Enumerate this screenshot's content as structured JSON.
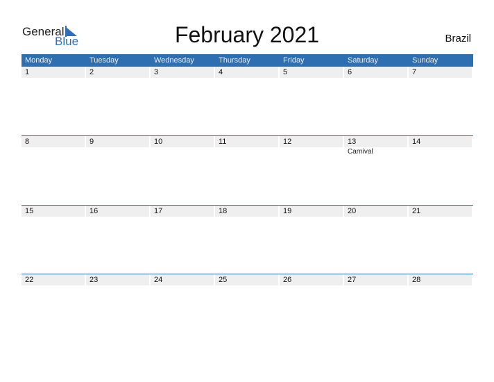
{
  "logo": {
    "general": "General",
    "blue": "Blue"
  },
  "title": "February 2021",
  "country": "Brazil",
  "weekdays": [
    "Monday",
    "Tuesday",
    "Wednesday",
    "Thursday",
    "Friday",
    "Saturday",
    "Sunday"
  ],
  "weeks": [
    {
      "days": [
        {
          "day": "1",
          "event": ""
        },
        {
          "day": "2",
          "event": ""
        },
        {
          "day": "3",
          "event": ""
        },
        {
          "day": "4",
          "event": ""
        },
        {
          "day": "5",
          "event": ""
        },
        {
          "day": "6",
          "event": ""
        },
        {
          "day": "7",
          "event": ""
        }
      ]
    },
    {
      "days": [
        {
          "day": "8",
          "event": ""
        },
        {
          "day": "9",
          "event": ""
        },
        {
          "day": "10",
          "event": ""
        },
        {
          "day": "11",
          "event": ""
        },
        {
          "day": "12",
          "event": ""
        },
        {
          "day": "13",
          "event": "Carnival"
        },
        {
          "day": "14",
          "event": ""
        }
      ]
    },
    {
      "days": [
        {
          "day": "15",
          "event": ""
        },
        {
          "day": "16",
          "event": ""
        },
        {
          "day": "17",
          "event": ""
        },
        {
          "day": "18",
          "event": ""
        },
        {
          "day": "19",
          "event": ""
        },
        {
          "day": "20",
          "event": ""
        },
        {
          "day": "21",
          "event": ""
        }
      ]
    },
    {
      "days": [
        {
          "day": "22",
          "event": ""
        },
        {
          "day": "23",
          "event": ""
        },
        {
          "day": "24",
          "event": ""
        },
        {
          "day": "25",
          "event": ""
        },
        {
          "day": "26",
          "event": ""
        },
        {
          "day": "27",
          "event": ""
        },
        {
          "day": "28",
          "event": ""
        }
      ]
    }
  ],
  "colors": {
    "accent": "#2e6fb1",
    "day_band": "#efefef"
  }
}
